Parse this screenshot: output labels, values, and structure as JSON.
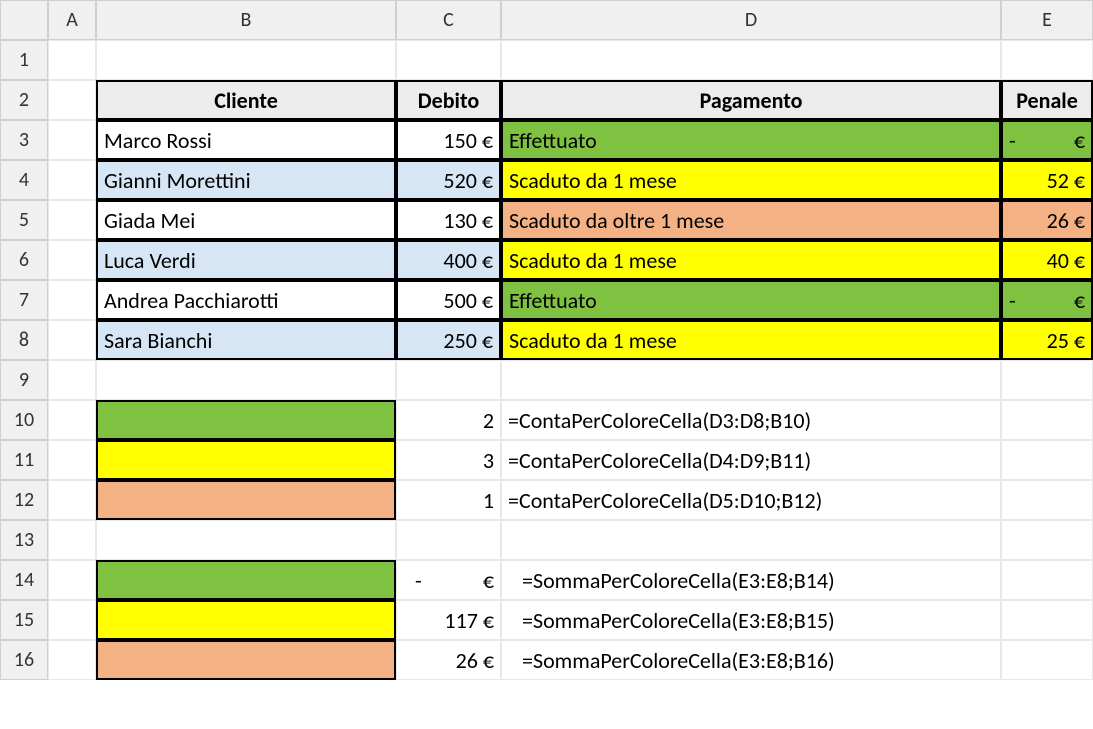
{
  "columns": [
    "A",
    "B",
    "C",
    "D",
    "E"
  ],
  "rows": [
    "1",
    "2",
    "3",
    "4",
    "5",
    "6",
    "7",
    "8",
    "9",
    "10",
    "11",
    "12",
    "13",
    "14",
    "15",
    "16"
  ],
  "headers": {
    "cliente": "Cliente",
    "debito": "Debito",
    "pagamento": "Pagamento",
    "penale": "Penale"
  },
  "data": [
    {
      "cliente": "Marco Rossi",
      "debito": "150 €",
      "pagamento": "Effettuato",
      "penale_pre": "-",
      "penale_suf": "€",
      "color": "green",
      "alt": false
    },
    {
      "cliente": "Gianni Morettini",
      "debito": "520 €",
      "pagamento": "Scaduto da 1 mese",
      "penale": "52 €",
      "color": "yellow",
      "alt": true
    },
    {
      "cliente": "Giada Mei",
      "debito": "130 €",
      "pagamento": "Scaduto da oltre 1 mese",
      "penale": "26 €",
      "color": "orange",
      "alt": false
    },
    {
      "cliente": "Luca Verdi",
      "debito": "400 €",
      "pagamento": "Scaduto da 1 mese",
      "penale": "40 €",
      "color": "yellow",
      "alt": true
    },
    {
      "cliente": "Andrea Pacchiarotti",
      "debito": "500 €",
      "pagamento": "Effettuato",
      "penale_pre": "-",
      "penale_suf": "€",
      "color": "green",
      "alt": false
    },
    {
      "cliente": "Sara Bianchi",
      "debito": "250 €",
      "pagamento": "Scaduto da 1 mese",
      "penale": "25 €",
      "color": "yellow",
      "alt": true
    }
  ],
  "count_block": [
    {
      "color": "green",
      "val": "2",
      "formula": "=ContaPerColoreCella(D3:D8;B10)"
    },
    {
      "color": "yellow",
      "val": "3",
      "formula": "=ContaPerColoreCella(D4:D9;B11)"
    },
    {
      "color": "orange",
      "val": "1",
      "formula": "=ContaPerColoreCella(D5:D10;B12)"
    }
  ],
  "sum_block": [
    {
      "color": "green",
      "val_pre": "-",
      "val_suf": "€",
      "formula": "=SommaPerColoreCella(E3:E8;B14)"
    },
    {
      "color": "yellow",
      "val": "117 €",
      "formula": "=SommaPerColoreCella(E3:E8;B15)"
    },
    {
      "color": "orange",
      "val": "26 €",
      "formula": "=SommaPerColoreCella(E3:E8;B16)"
    }
  ],
  "chart_data": {
    "type": "table",
    "title": "",
    "columns": [
      "Cliente",
      "Debito",
      "Pagamento",
      "Penale"
    ],
    "rows": [
      [
        "Marco Rossi",
        150,
        "Effettuato",
        0
      ],
      [
        "Gianni Morettini",
        520,
        "Scaduto da 1 mese",
        52
      ],
      [
        "Giada Mei",
        130,
        "Scaduto da oltre 1 mese",
        26
      ],
      [
        "Luca Verdi",
        400,
        "Scaduto da 1 mese",
        40
      ],
      [
        "Andrea Pacchiarotti",
        500,
        "Effettuato",
        0
      ],
      [
        "Sara Bianchi",
        250,
        "Scaduto da 1 mese",
        25
      ]
    ],
    "counts_by_color": {
      "green": 2,
      "yellow": 3,
      "orange": 1
    },
    "sums_by_color": {
      "green": 0,
      "yellow": 117,
      "orange": 26
    },
    "currency": "€"
  }
}
